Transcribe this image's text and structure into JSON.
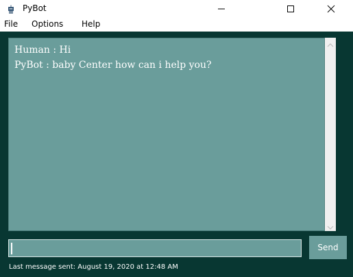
{
  "window": {
    "title": "PyBot",
    "app_icon": "robot-icon",
    "controls": [
      "minimize-icon",
      "maximize-icon",
      "close-icon"
    ]
  },
  "menu": {
    "items": [
      "File",
      "Options",
      "Help"
    ]
  },
  "chat": {
    "messages": [
      "Human : Hi",
      "PyBot : baby Center how can i help you?"
    ]
  },
  "input": {
    "value": ""
  },
  "send": {
    "label": "Send"
  },
  "status": {
    "text": "Last message sent: August 19, 2020 at 12:48 AM"
  },
  "colors": {
    "background": "#083732",
    "panel": "#6a9d9b",
    "text": "#ffffff"
  }
}
